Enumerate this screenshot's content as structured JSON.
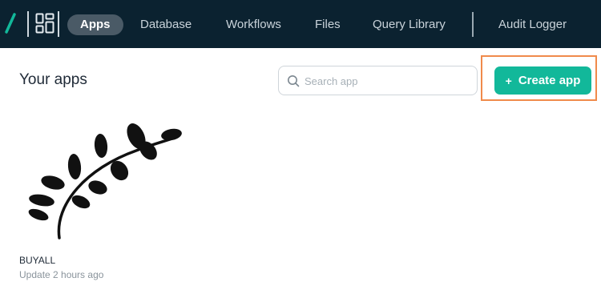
{
  "nav": {
    "items": [
      {
        "label": "Apps",
        "active": true
      },
      {
        "label": "Database",
        "active": false
      },
      {
        "label": "Workflows",
        "active": false
      },
      {
        "label": "Files",
        "active": false
      },
      {
        "label": "Query Library",
        "active": false
      },
      {
        "label": "Audit Logger",
        "active": false
      }
    ]
  },
  "main": {
    "title": "Your apps",
    "search": {
      "placeholder": "Search app",
      "value": ""
    },
    "create_button": {
      "label": "Create app",
      "icon": "plus-icon"
    }
  },
  "apps": [
    {
      "name": "BUYALL",
      "updated": "Update 2 hours ago",
      "thumbnail_icon": "leaf-branch-icon"
    }
  ],
  "colors": {
    "topbar": "#0b2230",
    "accent": "#12b89a",
    "highlight": "#f08a4b"
  }
}
